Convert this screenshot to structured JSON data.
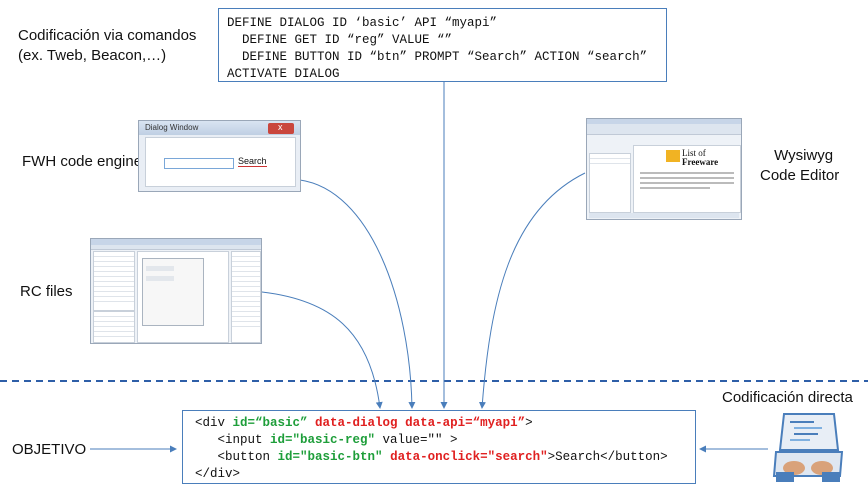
{
  "labels": {
    "cmd_title_1": "Codificación via comandos",
    "cmd_title_2": "(ex. Tweb, Beacon,…)",
    "fwh": "FWH code engine",
    "rc": "RC files",
    "wysiwyg_1": "Wysiwyg",
    "wysiwyg_2": "Code Editor",
    "direct": "Codificación directa",
    "objetivo": "OBJETIVO"
  },
  "command_code": [
    "DEFINE DIALOG ID ‘basic’ API “myapi”",
    "  DEFINE GET ID “reg” VALUE “”",
    "  DEFINE BUTTON ID “btn” PROMPT “Search” ACTION “search”",
    "ACTIVATE DIALOG"
  ],
  "html_code": {
    "l1_a": "<div ",
    "l1_b": "id=“basic”",
    "l1_c": " ",
    "l1_d": "data-dialog",
    "l1_e": " ",
    "l1_f": "data-api=“myapi”",
    "l1_g": ">",
    "l2_a": "   <input ",
    "l2_b": "id=\"basic-reg\"",
    "l2_c": " value=\"\" >",
    "l3_a": "   <button ",
    "l3_b": "id=\"basic-btn\"",
    "l3_c": " ",
    "l3_d": "data-onclick=\"search\"",
    "l3_e": ">Search</button>",
    "l4_a": "</div>"
  },
  "dialog_thumb": {
    "title": "Dialog Window",
    "button": "Search"
  },
  "wysiwyg_thumb": {
    "brand_1": "List of",
    "brand_2": "Freeware"
  },
  "colors": {
    "line": "#4a7ebb",
    "dashed": "#2e5fa8",
    "green": "#1e9e3a",
    "red": "#e02020"
  }
}
